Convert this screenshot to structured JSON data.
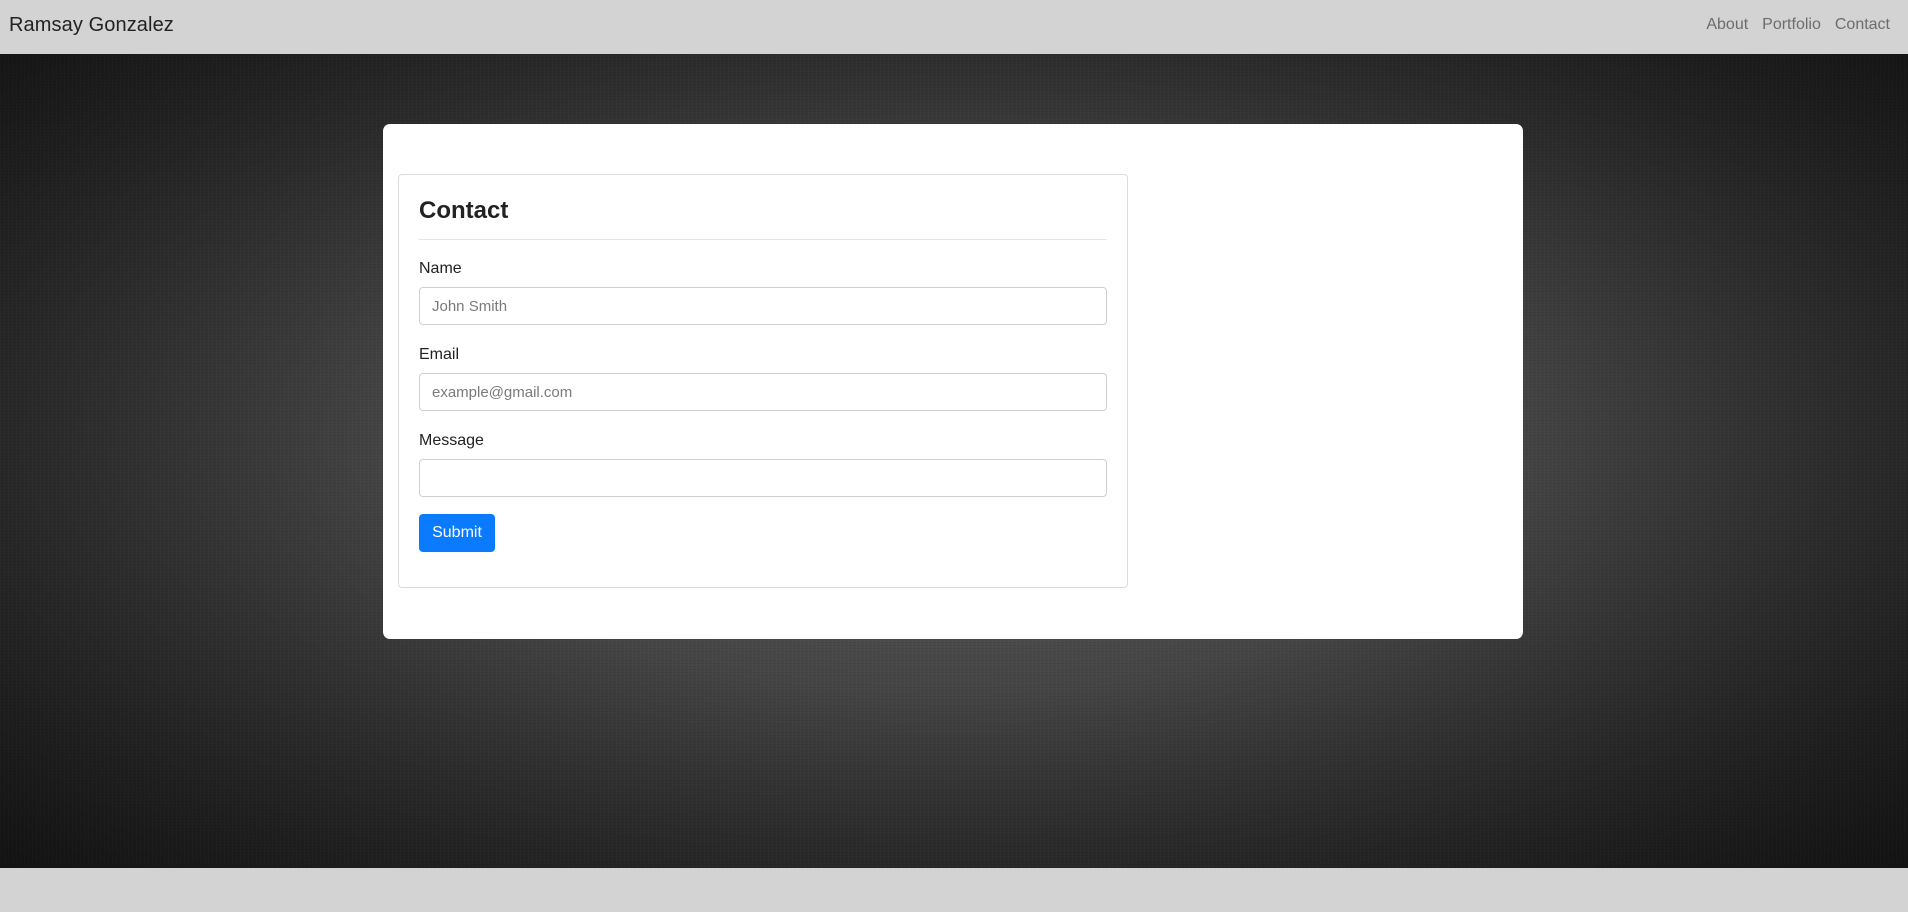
{
  "navbar": {
    "brand": "Ramsay Gonzalez",
    "links": [
      "About",
      "Portfolio",
      "Contact"
    ]
  },
  "contact_form": {
    "title": "Contact",
    "fields": {
      "name": {
        "label": "Name",
        "placeholder": "John Smith",
        "value": ""
      },
      "email": {
        "label": "Email",
        "placeholder": "example@gmail.com",
        "value": ""
      },
      "message": {
        "label": "Message",
        "placeholder": "",
        "value": ""
      }
    },
    "submit_label": "Submit"
  },
  "colors": {
    "navbar_bg": "#d3d3d3",
    "primary_button": "#0a7bff",
    "panel_bg": "#ffffff"
  }
}
